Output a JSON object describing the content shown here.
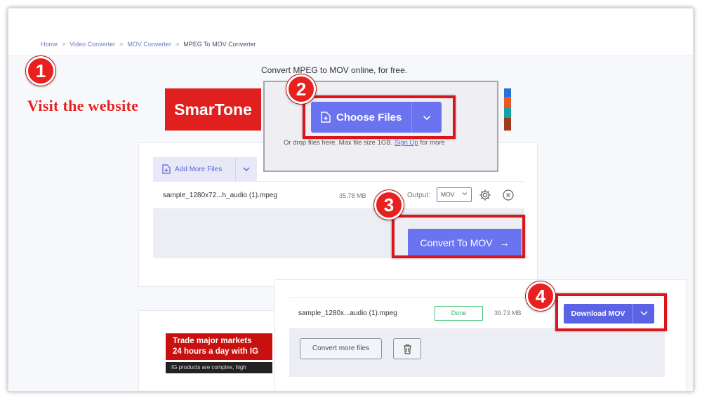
{
  "breadcrumb": [
    {
      "label": "Home"
    },
    {
      "label": "Video Converter"
    },
    {
      "label": "MOV Converter"
    },
    {
      "label": "MPEG To MOV Converter"
    }
  ],
  "breadcrumb_separator": ">",
  "headline": "Convert MPEG to MOV online, for free.",
  "annotations": {
    "step1": "1",
    "step1_label": "Visit the website",
    "step2": "2",
    "step3": "3",
    "step4": "4",
    "highlight_color": "#d8161c"
  },
  "ads": {
    "top_banner": "SmarTone",
    "bottom_line1": "Trade major markets",
    "bottom_line2": "24 hours a day with IG",
    "bottom_disclaimer": "IG products are complex, high"
  },
  "upload": {
    "choose_label": "Choose Files",
    "drop_text_before": "Or drop files here. Max file size 1GB.",
    "drop_link": "Sign Up",
    "drop_text_after": "for more"
  },
  "queue": {
    "add_more_label": "Add More Files",
    "file_name": "sample_1280x72...h_audio (1).mpeg",
    "file_size": "35.78 MB",
    "output_label": "Output:",
    "output_value": "MOV",
    "convert_label": "Convert To MOV",
    "convert_arrow": "→"
  },
  "result": {
    "file_name": "sample_1280x...audio (1).mpeg",
    "status": "Done",
    "file_size": "39.73 MB",
    "download_label": "Download MOV",
    "convert_more_label": "Convert more files"
  },
  "colors": {
    "accent": "#6a73f0",
    "done_green": "#3bae68",
    "annotation_red": "#e8201f"
  }
}
